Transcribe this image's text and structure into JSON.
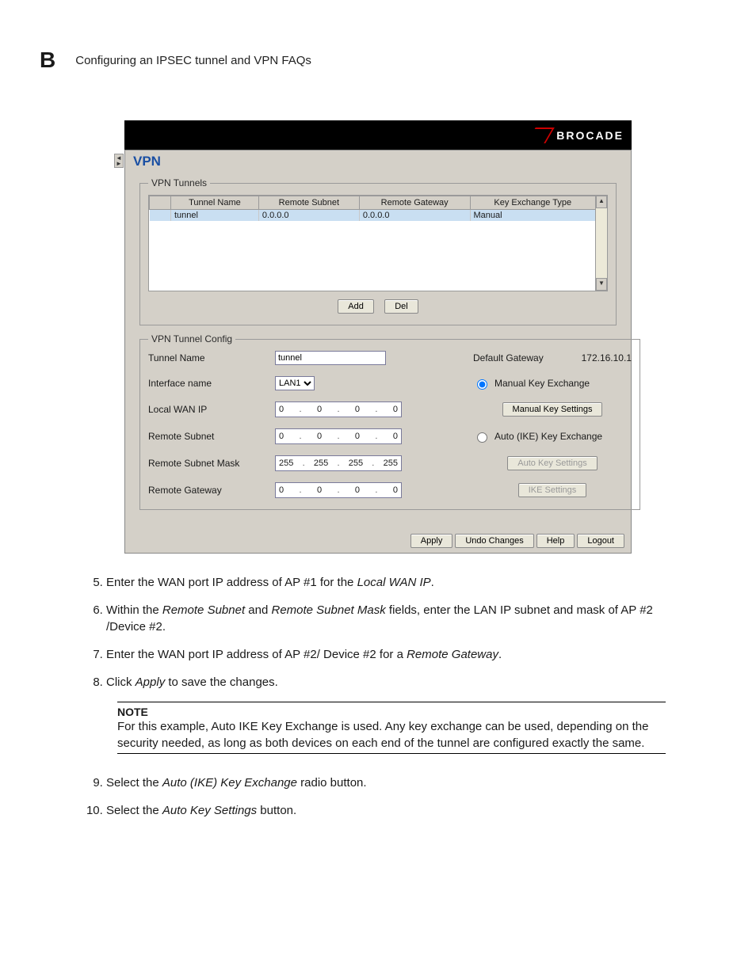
{
  "header": {
    "appendix_letter": "B",
    "title": "Configuring an IPSEC tunnel and VPN FAQs"
  },
  "brand": {
    "name": "BROCADE"
  },
  "panel": {
    "title": "VPN"
  },
  "tunnels_table": {
    "legend": "VPN Tunnels",
    "cols": [
      "Tunnel Name",
      "Remote Subnet",
      "Remote Gateway",
      "Key Exchange Type"
    ],
    "rows": [
      {
        "name": "tunnel",
        "subnet": "0.0.0.0",
        "gateway": "0.0.0.0",
        "key": "Manual"
      }
    ],
    "buttons": {
      "add": "Add",
      "del": "Del"
    }
  },
  "config": {
    "legend": "VPN Tunnel Config",
    "labels": {
      "tunnel_name": "Tunnel Name",
      "interface_name": "Interface name",
      "local_wan_ip": "Local WAN IP",
      "remote_subnet": "Remote Subnet",
      "remote_subnet_mask": "Remote Subnet Mask",
      "remote_gateway": "Remote Gateway",
      "default_gateway": "Default Gateway"
    },
    "values": {
      "tunnel_name": "tunnel",
      "interface_name": "LAN1",
      "local_wan_ip": [
        "0",
        "0",
        "0",
        "0"
      ],
      "remote_subnet": [
        "0",
        "0",
        "0",
        "0"
      ],
      "remote_subnet_mask": [
        "255",
        "255",
        "255",
        "255"
      ],
      "remote_gateway": [
        "0",
        "0",
        "0",
        "0"
      ],
      "default_gateway": "172.16.10.1"
    },
    "radios": {
      "manual": "Manual Key Exchange",
      "auto": "Auto (IKE) Key Exchange"
    },
    "buttons": {
      "manual_settings": "Manual Key Settings",
      "auto_settings": "Auto Key Settings",
      "ike_settings": "IKE Settings"
    }
  },
  "footer_buttons": {
    "apply": "Apply",
    "undo": "Undo Changes",
    "help": "Help",
    "logout": "Logout"
  },
  "instructions": {
    "i5": {
      "pre": "Enter the WAN port IP address of AP #1 for the ",
      "em": "Local WAN IP",
      "post": "."
    },
    "i6": {
      "p1": "Within the ",
      "e1": "Remote Subnet",
      "p2": " and ",
      "e2": "Remote Subnet Mask",
      "p3": " fields, enter the LAN IP subnet and mask of AP #2 /Device #2."
    },
    "i7": {
      "pre": "Enter the WAN port IP address of AP #2/ Device #2 for a ",
      "em": "Remote Gateway",
      "post": "."
    },
    "i8": {
      "pre": "Click ",
      "em": "Apply",
      "post": " to save the changes."
    },
    "i9": {
      "pre": "Select the ",
      "em": "Auto (IKE) Key Exchange",
      "post": " radio button."
    },
    "i10": {
      "pre": "Select the ",
      "em": "Auto Key Settings",
      "post": " button."
    }
  },
  "note": {
    "heading": "NOTE",
    "body": "For this example, Auto IKE Key Exchange is used. Any key exchange can be used, depending on the security needed, as long as both devices on each end of the tunnel are configured exactly the same."
  }
}
